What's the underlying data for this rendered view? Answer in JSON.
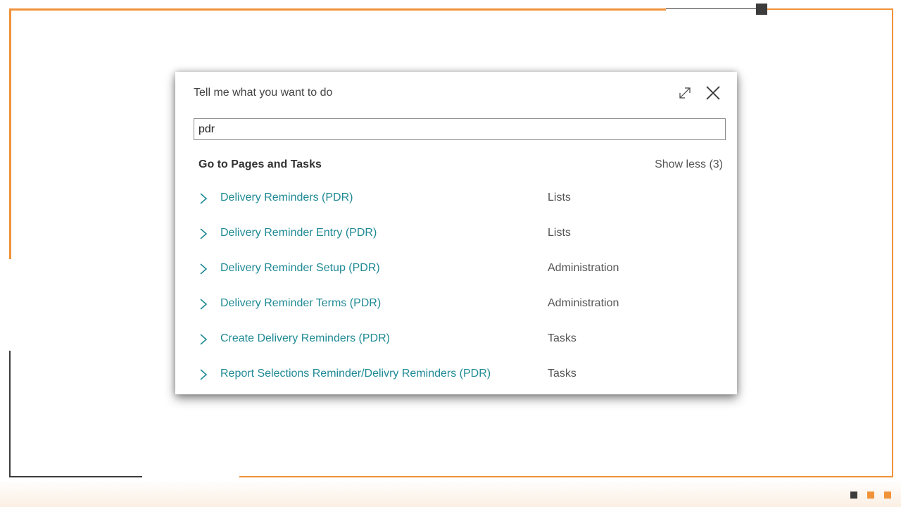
{
  "dialog": {
    "title": "Tell me what you want to do",
    "search_value": "pdr",
    "section_title": "Go to Pages and Tasks",
    "show_less": "Show less (3)",
    "results": [
      {
        "name": "Delivery Reminders (PDR)",
        "category": "Lists"
      },
      {
        "name": "Delivery Reminder Entry (PDR)",
        "category": "Lists"
      },
      {
        "name": "Delivery Reminder Setup (PDR)",
        "category": "Administration"
      },
      {
        "name": "Delivery Reminder Terms (PDR)",
        "category": "Administration"
      },
      {
        "name": "Create Delivery Reminders (PDR)",
        "category": "Tasks"
      },
      {
        "name": "Report Selections Reminder/Delivry Reminders (PDR)",
        "category": "Tasks"
      }
    ]
  },
  "icons": {
    "expand": "expand-icon",
    "close": "close-icon",
    "chevron": "chevron-right-icon"
  },
  "colors": {
    "accent_orange": "#f0923a",
    "frame_dark": "#3c3c3c",
    "link_teal": "#1f8a95"
  }
}
